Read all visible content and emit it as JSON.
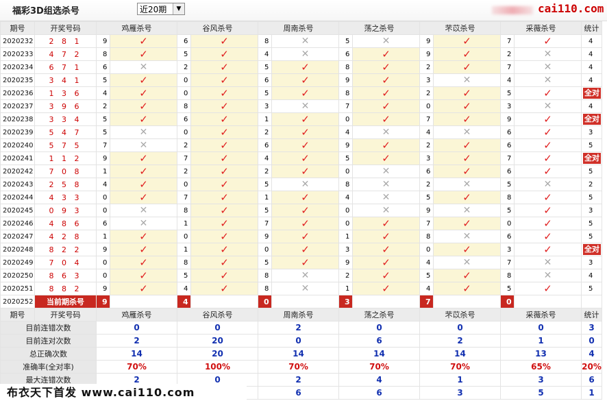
{
  "header": {
    "title": "福彩3D组选杀号",
    "select_value": "近20期",
    "site": "cai110.com"
  },
  "columns": [
    "期号",
    "开奖号码",
    "鸡雁杀号",
    "谷风杀号",
    "周南杀号",
    "荡之杀号",
    "芣苡杀号",
    "采薇杀号",
    "统计"
  ],
  "rows": [
    {
      "issue": "2020232",
      "num": "2 8 1",
      "v": [
        [
          "9",
          "ok",
          true
        ],
        [
          "6",
          "ok",
          true
        ],
        [
          "8",
          "no",
          false
        ],
        [
          "5",
          "no",
          false
        ],
        [
          "9",
          "ok",
          true
        ],
        [
          "7",
          "ok",
          false
        ]
      ],
      "total": "4"
    },
    {
      "issue": "2020233",
      "num": "4 7 2",
      "v": [
        [
          "8",
          "ok",
          true
        ],
        [
          "5",
          "ok",
          true
        ],
        [
          "4",
          "no",
          false
        ],
        [
          "6",
          "ok",
          true
        ],
        [
          "9",
          "ok",
          true
        ],
        [
          "2",
          "no",
          false
        ]
      ],
      "total": "4"
    },
    {
      "issue": "2020234",
      "num": "6 7 1",
      "v": [
        [
          "6",
          "no",
          false
        ],
        [
          "2",
          "ok",
          true
        ],
        [
          "5",
          "ok",
          true
        ],
        [
          "8",
          "ok",
          true
        ],
        [
          "2",
          "ok",
          true
        ],
        [
          "7",
          "no",
          false
        ]
      ],
      "total": "4"
    },
    {
      "issue": "2020235",
      "num": "3 4 1",
      "v": [
        [
          "5",
          "ok",
          true
        ],
        [
          "0",
          "ok",
          true
        ],
        [
          "6",
          "ok",
          true
        ],
        [
          "9",
          "ok",
          true
        ],
        [
          "3",
          "no",
          false
        ],
        [
          "4",
          "no",
          false
        ]
      ],
      "total": "4"
    },
    {
      "issue": "2020236",
      "num": "1 3 6",
      "v": [
        [
          "4",
          "ok",
          true
        ],
        [
          "0",
          "ok",
          true
        ],
        [
          "5",
          "ok",
          true
        ],
        [
          "8",
          "ok",
          true
        ],
        [
          "2",
          "ok",
          true
        ],
        [
          "5",
          "ok",
          false
        ]
      ],
      "total": "全对",
      "full": true
    },
    {
      "issue": "2020237",
      "num": "3 9 6",
      "v": [
        [
          "2",
          "ok",
          true
        ],
        [
          "8",
          "ok",
          true
        ],
        [
          "3",
          "no",
          false
        ],
        [
          "7",
          "ok",
          true
        ],
        [
          "0",
          "ok",
          true
        ],
        [
          "3",
          "no",
          false
        ]
      ],
      "total": "4"
    },
    {
      "issue": "2020238",
      "num": "3 3 4",
      "v": [
        [
          "5",
          "ok",
          true
        ],
        [
          "6",
          "ok",
          true
        ],
        [
          "1",
          "ok",
          true
        ],
        [
          "0",
          "ok",
          true
        ],
        [
          "7",
          "ok",
          true
        ],
        [
          "9",
          "ok",
          false
        ]
      ],
      "total": "全对",
      "full": true
    },
    {
      "issue": "2020239",
      "num": "5 4 7",
      "v": [
        [
          "5",
          "no",
          false
        ],
        [
          "0",
          "ok",
          true
        ],
        [
          "2",
          "ok",
          true
        ],
        [
          "4",
          "no",
          false
        ],
        [
          "4",
          "no",
          false
        ],
        [
          "6",
          "ok",
          false
        ]
      ],
      "total": "3"
    },
    {
      "issue": "2020240",
      "num": "5 7 5",
      "v": [
        [
          "7",
          "no",
          false
        ],
        [
          "2",
          "ok",
          true
        ],
        [
          "6",
          "ok",
          true
        ],
        [
          "9",
          "ok",
          true
        ],
        [
          "2",
          "ok",
          true
        ],
        [
          "6",
          "ok",
          false
        ]
      ],
      "total": "5"
    },
    {
      "issue": "2020241",
      "num": "1 1 2",
      "v": [
        [
          "9",
          "ok",
          true
        ],
        [
          "7",
          "ok",
          true
        ],
        [
          "4",
          "ok",
          true
        ],
        [
          "5",
          "ok",
          true
        ],
        [
          "3",
          "ok",
          true
        ],
        [
          "7",
          "ok",
          false
        ]
      ],
      "total": "全对",
      "full": true
    },
    {
      "issue": "2020242",
      "num": "7 0 8",
      "v": [
        [
          "1",
          "ok",
          true
        ],
        [
          "2",
          "ok",
          true
        ],
        [
          "2",
          "ok",
          true
        ],
        [
          "0",
          "no",
          false
        ],
        [
          "6",
          "ok",
          true
        ],
        [
          "6",
          "ok",
          false
        ]
      ],
      "total": "5"
    },
    {
      "issue": "2020243",
      "num": "2 5 8",
      "v": [
        [
          "4",
          "ok",
          true
        ],
        [
          "0",
          "ok",
          true
        ],
        [
          "5",
          "no",
          false
        ],
        [
          "8",
          "no",
          false
        ],
        [
          "2",
          "no",
          false
        ],
        [
          "5",
          "no",
          false
        ]
      ],
      "total": "2"
    },
    {
      "issue": "2020244",
      "num": "4 3 3",
      "v": [
        [
          "0",
          "ok",
          true
        ],
        [
          "7",
          "ok",
          true
        ],
        [
          "1",
          "ok",
          true
        ],
        [
          "4",
          "no",
          false
        ],
        [
          "5",
          "ok",
          true
        ],
        [
          "8",
          "ok",
          false
        ]
      ],
      "total": "5"
    },
    {
      "issue": "2020245",
      "num": "0 9 3",
      "v": [
        [
          "0",
          "no",
          false
        ],
        [
          "8",
          "ok",
          true
        ],
        [
          "5",
          "ok",
          true
        ],
        [
          "0",
          "no",
          false
        ],
        [
          "9",
          "no",
          false
        ],
        [
          "5",
          "ok",
          false
        ]
      ],
      "total": "3"
    },
    {
      "issue": "2020246",
      "num": "4 8 6",
      "v": [
        [
          "6",
          "no",
          false
        ],
        [
          "1",
          "ok",
          true
        ],
        [
          "7",
          "ok",
          true
        ],
        [
          "0",
          "ok",
          true
        ],
        [
          "7",
          "ok",
          true
        ],
        [
          "0",
          "ok",
          false
        ]
      ],
      "total": "5"
    },
    {
      "issue": "2020247",
      "num": "4 2 8",
      "v": [
        [
          "1",
          "ok",
          true
        ],
        [
          "0",
          "ok",
          true
        ],
        [
          "9",
          "ok",
          true
        ],
        [
          "1",
          "ok",
          true
        ],
        [
          "8",
          "no",
          false
        ],
        [
          "6",
          "ok",
          false
        ]
      ],
      "total": "5"
    },
    {
      "issue": "2020248",
      "num": "8 2 2",
      "v": [
        [
          "9",
          "ok",
          true
        ],
        [
          "1",
          "ok",
          true
        ],
        [
          "0",
          "ok",
          true
        ],
        [
          "3",
          "ok",
          true
        ],
        [
          "0",
          "ok",
          true
        ],
        [
          "3",
          "ok",
          false
        ]
      ],
      "total": "全对",
      "full": true
    },
    {
      "issue": "2020249",
      "num": "7 0 4",
      "v": [
        [
          "0",
          "ok",
          true
        ],
        [
          "8",
          "ok",
          true
        ],
        [
          "5",
          "ok",
          true
        ],
        [
          "9",
          "ok",
          true
        ],
        [
          "4",
          "no",
          false
        ],
        [
          "7",
          "no",
          false
        ]
      ],
      "total": "3"
    },
    {
      "issue": "2020250",
      "num": "8 6 3",
      "v": [
        [
          "0",
          "ok",
          true
        ],
        [
          "5",
          "ok",
          true
        ],
        [
          "8",
          "no",
          false
        ],
        [
          "2",
          "ok",
          true
        ],
        [
          "5",
          "ok",
          true
        ],
        [
          "8",
          "no",
          false
        ]
      ],
      "total": "4"
    },
    {
      "issue": "2020251",
      "num": "8 8 2",
      "v": [
        [
          "9",
          "ok",
          true
        ],
        [
          "4",
          "ok",
          true
        ],
        [
          "8",
          "no",
          false
        ],
        [
          "1",
          "ok",
          true
        ],
        [
          "4",
          "ok",
          true
        ],
        [
          "5",
          "ok",
          false
        ]
      ],
      "total": "5"
    }
  ],
  "current": {
    "issue": "2020252",
    "label": "当前期杀号",
    "values": [
      "9",
      "4",
      "0",
      "3",
      "7",
      "0"
    ]
  },
  "stats": [
    {
      "label": "目前连错次数",
      "values": [
        "0",
        "0",
        "2",
        "0",
        "0",
        "0",
        "3"
      ],
      "color": "blue"
    },
    {
      "label": "目前连对次数",
      "values": [
        "2",
        "20",
        "0",
        "6",
        "2",
        "1",
        "0"
      ],
      "color": "blue"
    },
    {
      "label": "总正确次数",
      "values": [
        "14",
        "20",
        "14",
        "14",
        "14",
        "13",
        "4"
      ],
      "color": "blue"
    },
    {
      "label": "准确率(全对率)",
      "values": [
        "70%",
        "100%",
        "70%",
        "70%",
        "70%",
        "65%",
        "20%"
      ],
      "color": "red"
    },
    {
      "label": "最大连错次数",
      "values": [
        "2",
        "0",
        "2",
        "4",
        "1",
        "3",
        "6"
      ],
      "color": "blue"
    },
    {
      "label": "",
      "values": [
        "",
        "",
        "6",
        "6",
        "3",
        "5",
        "1"
      ],
      "color": "blue"
    }
  ],
  "banner": "布衣天下首发 www.cai110.com",
  "icons": {
    "ok": "check-icon",
    "no": "cross-icon"
  }
}
